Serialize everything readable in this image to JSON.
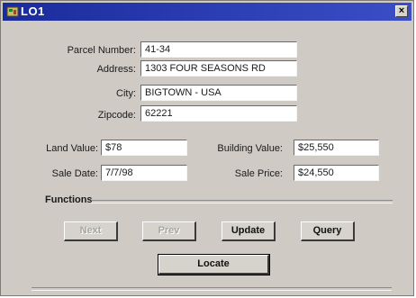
{
  "window": {
    "title": "LO1",
    "close_glyph": "×",
    "icon": "app-icon",
    "colors": {
      "titlebar": "#1a2b9c",
      "face": "#cfcbc4"
    }
  },
  "parcel": {
    "number_label": "Parcel Number:",
    "number_value": "41-34",
    "address_label": "Address:",
    "address_value": "1303 FOUR SEASONS RD",
    "city_label": "City:",
    "city_value": "BIGTOWN - USA",
    "zip_label": "Zipcode:",
    "zip_value": "62221"
  },
  "values": {
    "land_label": "Land Value:",
    "land_value": "$78",
    "building_label": "Building Value:",
    "building_value": "$25,550",
    "sale_date_label": "Sale Date:",
    "sale_date_value": "7/7/98",
    "sale_price_label": "Sale Price:",
    "sale_price_value": "$24,550"
  },
  "functions": {
    "group_label": "Functions",
    "next_label": "Next",
    "prev_label": "Prev",
    "update_label": "Update",
    "query_label": "Query",
    "locate_label": "Locate"
  }
}
